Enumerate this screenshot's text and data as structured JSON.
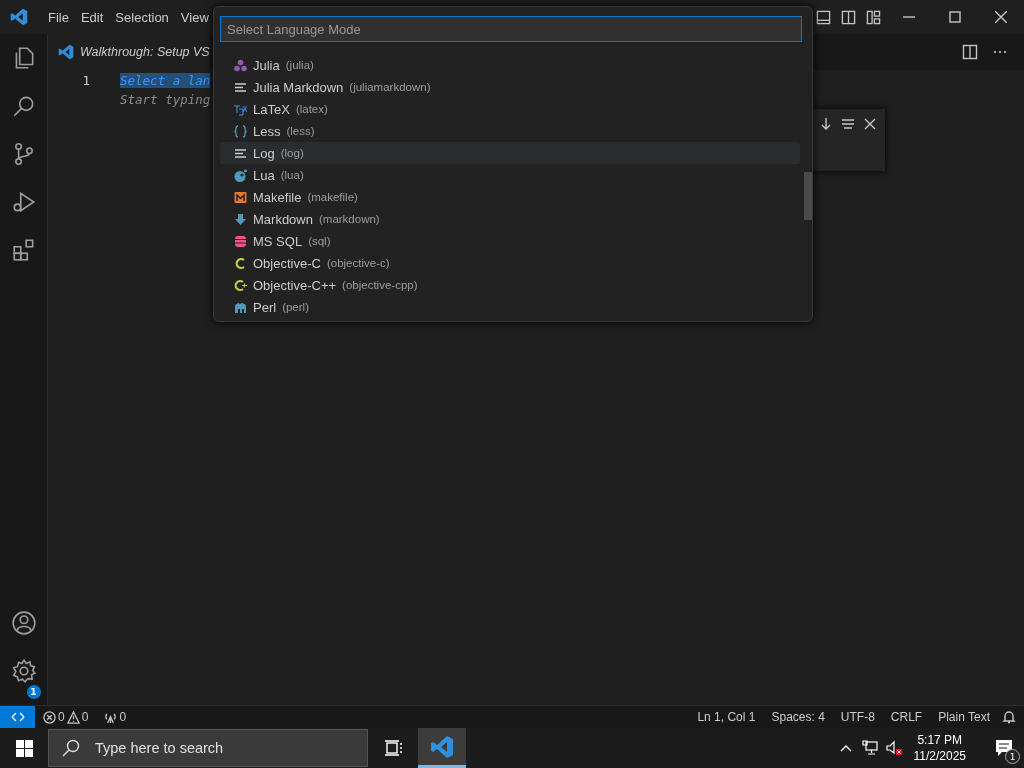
{
  "title_bar": {
    "menus": [
      "File",
      "Edit",
      "Selection",
      "View"
    ]
  },
  "editor": {
    "tab": {
      "title": "Walkthrough: Setup VS",
      "selected": true
    },
    "lines": [
      {
        "number": "1",
        "text": "Select a lan",
        "hint": "Start typing"
      }
    ]
  },
  "quick_pick": {
    "placeholder": "Select Language Mode",
    "items": [
      {
        "kind": "julia",
        "label": "Julia",
        "id": "(julia)",
        "selected": false
      },
      {
        "kind": "lines",
        "label": "Julia Markdown",
        "id": "(juliamarkdown)",
        "selected": false
      },
      {
        "kind": "tex",
        "label": "LaTeX",
        "id": "(latex)",
        "selected": false
      },
      {
        "kind": "braces",
        "label": "Less",
        "id": "(less)",
        "selected": false
      },
      {
        "kind": "lines",
        "label": "Log",
        "id": "(log)",
        "selected": true
      },
      {
        "kind": "lua",
        "label": "Lua",
        "id": "(lua)",
        "selected": false
      },
      {
        "kind": "makefile",
        "label": "Makefile",
        "id": "(makefile)",
        "selected": false
      },
      {
        "kind": "markdown",
        "label": "Markdown",
        "id": "(markdown)",
        "selected": false
      },
      {
        "kind": "sql",
        "label": "MS SQL",
        "id": "(sql)",
        "selected": false
      },
      {
        "kind": "objc",
        "label": "Objective-C",
        "id": "(objective-c)",
        "selected": false
      },
      {
        "kind": "objcpp",
        "label": "Objective-C++",
        "id": "(objective-cpp)",
        "selected": false
      },
      {
        "kind": "perl",
        "label": "Perl",
        "id": "(perl)",
        "selected": false
      }
    ]
  },
  "activity_bar": {
    "settings_badge": "1"
  },
  "status_bar": {
    "problems": [
      {
        "kind": "error",
        "count": "0"
      },
      {
        "kind": "warning",
        "count": "0"
      }
    ],
    "ports": "0",
    "items": [
      "Ln 1, Col 1",
      "Spaces: 4",
      "UTF-8",
      "CRLF",
      "Plain Text"
    ]
  },
  "taskbar": {
    "search_placeholder": "Type here to search",
    "time": "5:17 PM",
    "date": "11/2/2025",
    "notification_badge": "1"
  }
}
